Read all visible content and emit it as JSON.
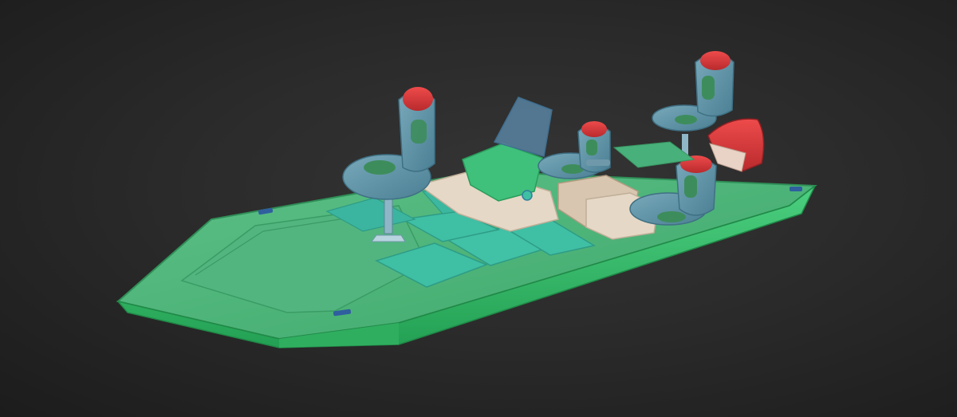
{
  "scene": {
    "subject": "bass-boat-3d-model",
    "colors": {
      "background": "#2b2b2b",
      "hull": "#37b96a",
      "hull_dark": "#249a52",
      "hull_light": "#57d489",
      "deck": "#4fb37a",
      "hatch": "#3fbfa4",
      "seat_body": "#5f93a6",
      "seat_cushion": "#3d8d5c",
      "seat_top": "#d9363a",
      "console": "#e6d8c6",
      "windshield": "#5f8fb0",
      "motor_cover": "#d73a3c"
    }
  }
}
